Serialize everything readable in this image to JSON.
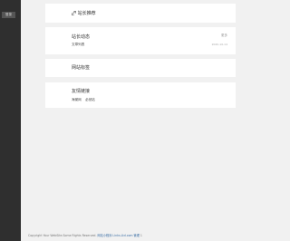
{
  "sidebar": {
    "tag_label": "登录"
  },
  "cards": {
    "recommend": {
      "icon": "link-icon",
      "title": "站长推荐"
    },
    "dynamics": {
      "title": "站长动态",
      "more": "更多",
      "item": "文章列表",
      "date": "2020-10-14"
    },
    "notice": {
      "title": "网站标签"
    },
    "friends": {
      "title": "友情链接",
      "links": [
        "海棠网",
        "必然站"
      ]
    }
  },
  "footer": {
    "text": "Copyright Your WebSite.Some Rights Reserved.",
    "link": "网站小程序 Links.Ltd.com 管理",
    "suffix": "1"
  },
  "colors": {
    "sidebar": "#2f2f2f",
    "background": "#f1f1f1",
    "card": "#ffffff",
    "link": "#3a6ea5"
  }
}
